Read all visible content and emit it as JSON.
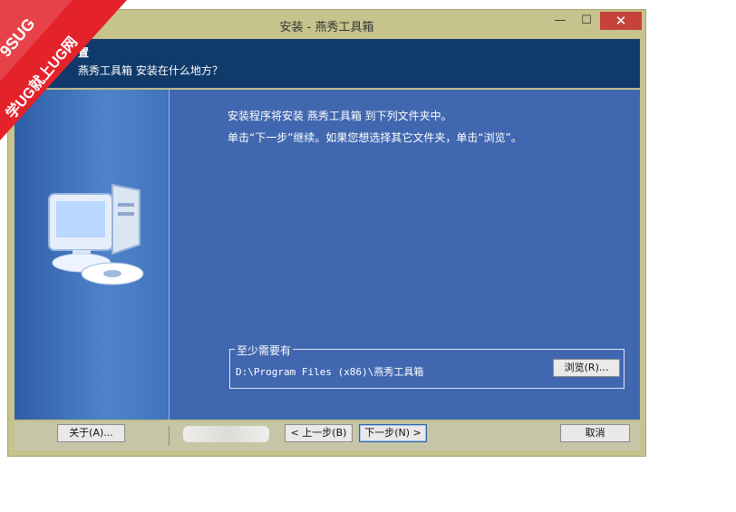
{
  "window": {
    "title": "安装 - 燕秀工具箱",
    "controls": {
      "min": "—",
      "max": "☐",
      "close": "✕"
    }
  },
  "header": {
    "title_fragment": "置",
    "subtitle": "燕秀工具箱 安装在什么地方？"
  },
  "body": {
    "line1": "安装程序将安装 燕秀工具箱 到下列文件夹中。",
    "line2": "单击“下一步”继续。如果您想选择其它文件夹，单击“浏览”。",
    "group_label": "至少需要有",
    "path": "D:\\Program Files (x86)\\燕秀工具箱",
    "browse_label": "浏览(R)..."
  },
  "footer": {
    "about_label": "关于(A)...",
    "prev_label": "< 上一步(B)",
    "next_label": "下一步(N) >",
    "cancel_label": "取消"
  },
  "watermark": {
    "line1": "9SUG",
    "line2": "学UG就上UG网"
  },
  "colors": {
    "window_frame": "#c6c48c",
    "header_bg": "#0f3a6a",
    "main_bg": "#4167b0",
    "close_btn": "#c7413b",
    "watermark_red": "#e3222a"
  }
}
